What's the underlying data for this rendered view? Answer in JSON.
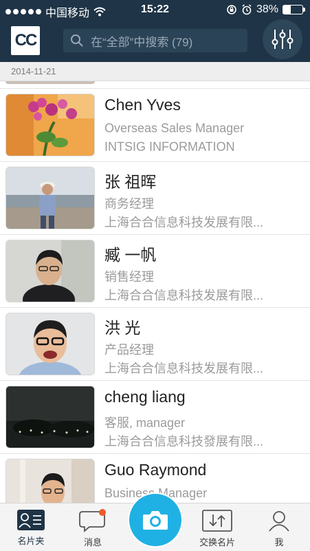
{
  "status_bar": {
    "carrier": "中国移动",
    "time": "15:22",
    "battery_text": "38%",
    "battery_level": 0.38
  },
  "header": {
    "logo_text": "CC",
    "search_placeholder": "在“全部”中搜索 (79)"
  },
  "section_date": "2014-11-21",
  "contacts": [
    {
      "name": "Chen Yves",
      "title": "Overseas Sales Manager",
      "company": "INTSIG INFORMATION"
    },
    {
      "name": "张 祖晖",
      "title": "商务经理",
      "company": "上海合合信息科技发展有限..."
    },
    {
      "name": "臧 一帆",
      "title": "销售经理",
      "company": "上海合合信息科技发展有限..."
    },
    {
      "name": "洪 光",
      "title": "产品经理",
      "company": "上海合合信息科技发展有限..."
    },
    {
      "name": "cheng liang",
      "title": "客服, manager",
      "company": "上海合合信息科技發展有限..."
    },
    {
      "name": "Guo Raymond",
      "title": "Business Manager",
      "company": ""
    }
  ],
  "tabbar": {
    "tabs": [
      {
        "label": "名片夹",
        "icon": "contacts-icon"
      },
      {
        "label": "消息",
        "icon": "message-icon"
      },
      {
        "label": "交换名片",
        "icon": "exchange-icon"
      },
      {
        "label": "我",
        "icon": "profile-icon"
      }
    ],
    "camera_icon": "camera-icon"
  },
  "colors": {
    "header_bg": "#1f3446",
    "accent": "#20b1e4",
    "badge": "#f05a28"
  }
}
